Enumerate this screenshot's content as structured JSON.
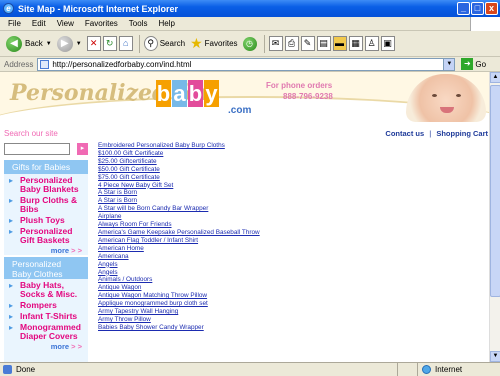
{
  "window": {
    "title": "Site Map - Microsoft Internet Explorer",
    "min": "_",
    "max": "□",
    "close": "x"
  },
  "menu": [
    "File",
    "Edit",
    "View",
    "Favorites",
    "Tools",
    "Help"
  ],
  "toolbar": {
    "back": "Back",
    "search": "Search",
    "favorites": "Favorites"
  },
  "address": {
    "label": "Address",
    "url": "http://personalizedforbaby.com/ind.html",
    "go": "Go"
  },
  "banner": {
    "logo_text": "Personalized for",
    "logo_blocks": [
      "b",
      "a",
      "b",
      "y"
    ],
    "logo_suffix": ".com",
    "phone_label": "For phone orders",
    "phone_number": "888-796-9238"
  },
  "top_links": {
    "contact": "Contact us",
    "cart": "Shopping Cart",
    "separator": "|"
  },
  "sidebar": {
    "search_label": "Search our site",
    "search_value": "",
    "gifts_heading": "Gifts for Babies",
    "gifts_items": [
      "Personalized Baby Blankets",
      "Burp Cloths & Bibs",
      "Plush Toys",
      "Personalized Gift Baskets"
    ],
    "clothes_heading": "Personalized Baby Clothes",
    "clothes_items": [
      "Baby Hats, Socks & Misc.",
      "Rompers",
      "Infant T-Shirts",
      "Monogrammed Diaper Covers"
    ],
    "more_label": "more",
    "more_arrows": "> >"
  },
  "sitemap_links": [
    "Embroidered Personalized Baby Burp Cloths",
    "$100.00 Gift Certificate",
    "$25.00 Giftcertificate",
    "$50.00 Gift Certificate",
    "$75.00 Gift Certificate",
    "4 Piece New Baby Gift Set",
    "A Star is Born",
    "A Star is Born",
    "A Star will be Born Candy Bar Wrapper",
    "Airplane",
    "Always Room For Friends",
    "America's Game Keepsake Personalized Baseball Throw",
    "American Flag Toddler / Infant Shirt",
    "American Home",
    "Americana",
    "Angels",
    "Angels",
    "Animals / Outdoors",
    "Antique Wagon",
    "Antique Wagon Matching Throw Pillow",
    "Applique monogrammed burp cloth set",
    "Army Tapestry Wall Hanging",
    "Army Throw Pillow",
    "Babies Baby Shower Candy Wrapper"
  ],
  "status": {
    "text": "Done",
    "zone": "Internet"
  }
}
